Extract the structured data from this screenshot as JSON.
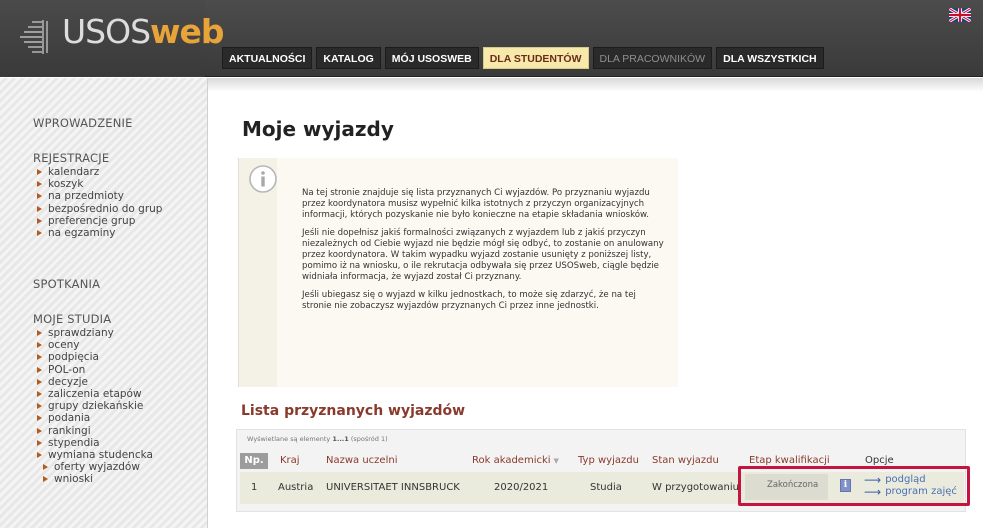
{
  "header": {
    "logo_uso": "USOS",
    "logo_web": "web",
    "nav": [
      {
        "label": "AKTUALNOŚCI",
        "state": "normal"
      },
      {
        "label": "KATALOG",
        "state": "normal"
      },
      {
        "label": "MÓJ USOSWEB",
        "state": "normal"
      },
      {
        "label": "DLA STUDENTÓW",
        "state": "active"
      },
      {
        "label": "DLA PRACOWNIKÓW",
        "state": "muted"
      },
      {
        "label": "DLA WSZYSTKICH",
        "state": "normal"
      }
    ],
    "language_flag": "uk-flag-icon"
  },
  "sidebar": {
    "wprowadzenie": "WPROWADZENIE",
    "rejestracje": {
      "heading": "REJESTRACJE",
      "items": [
        "kalendarz",
        "koszyk",
        "na przedmioty",
        "bezpośrednio do grup",
        "preferencje grup",
        "na egzaminy"
      ]
    },
    "spotkania": "SPOTKANIA",
    "moje_studia": {
      "heading": "MOJE STUDIA",
      "items": [
        "sprawdziany",
        "oceny",
        "podpięcia",
        "POL-on",
        "decyzje",
        "zaliczenia etapów",
        "grupy dziekańskie",
        "podania",
        "rankingi",
        "stypendia",
        "wymiana studencka"
      ],
      "sub_items": [
        "oferty wyjazdów",
        "wnioski"
      ]
    }
  },
  "main": {
    "title": "Moje wyjazdy",
    "info_icon": "info-icon",
    "info_paragraphs": [
      "Na tej stronie znajduje się lista przyznanych Ci wyjazdów. Po przyznaniu wyjazdu przez koordynatora musisz wypełnić kilka istotnych z przyczyn organizacyjnych informacji, których pozyskanie nie było konieczne na etapie składania wniosków.",
      "Jeśli nie dopełnisz jakiś formalności związanych z wyjazdem lub z jakiś przyczyn niezależnych od Ciebie wyjazd nie będzie mógł się odbyć, to zostanie on anulowany przez koordynatora. W takim wypadku wyjazd zostanie usunięty z poniższej listy, pomimo iż na wniosku, o ile rekrutacja odbywała się przez USOSweb, ciągle będzie widniała informacja, że wyjazd został Ci przyznany.",
      "Jeśli ubiegasz się o wyjazd w kilku jednostkach, to może się zdarzyć, że na tej stronie nie zobaczysz wyjazdów przyznanych Ci przez inne jednostki."
    ],
    "list_title": "Lista przyznanych wyjazdów",
    "table_info_prefix": "Wyświetlane są elementy ",
    "table_info_range": "1...1",
    "table_info_suffix": " (spośród 1)",
    "columns": {
      "np": "Np.",
      "kraj": "Kraj",
      "nazwa": "Nazwa uczelni",
      "rok": "Rok akademicki",
      "typ": "Typ wyjazdu",
      "stan": "Stan wyjazdu",
      "etap": "Etap kwalifikacji",
      "opcje": "Opcje"
    },
    "row": {
      "np": "1",
      "kraj": "Austria",
      "nazwa": "UNIVERSITAET INNSBRUCK",
      "rok": "2020/2021",
      "typ": "Studia",
      "stan": "W przygotowaniu",
      "etap": "Zakończona",
      "status_icon": "info-square-icon",
      "link_podglad": "podgląd",
      "link_program": "program zajęć"
    }
  }
}
